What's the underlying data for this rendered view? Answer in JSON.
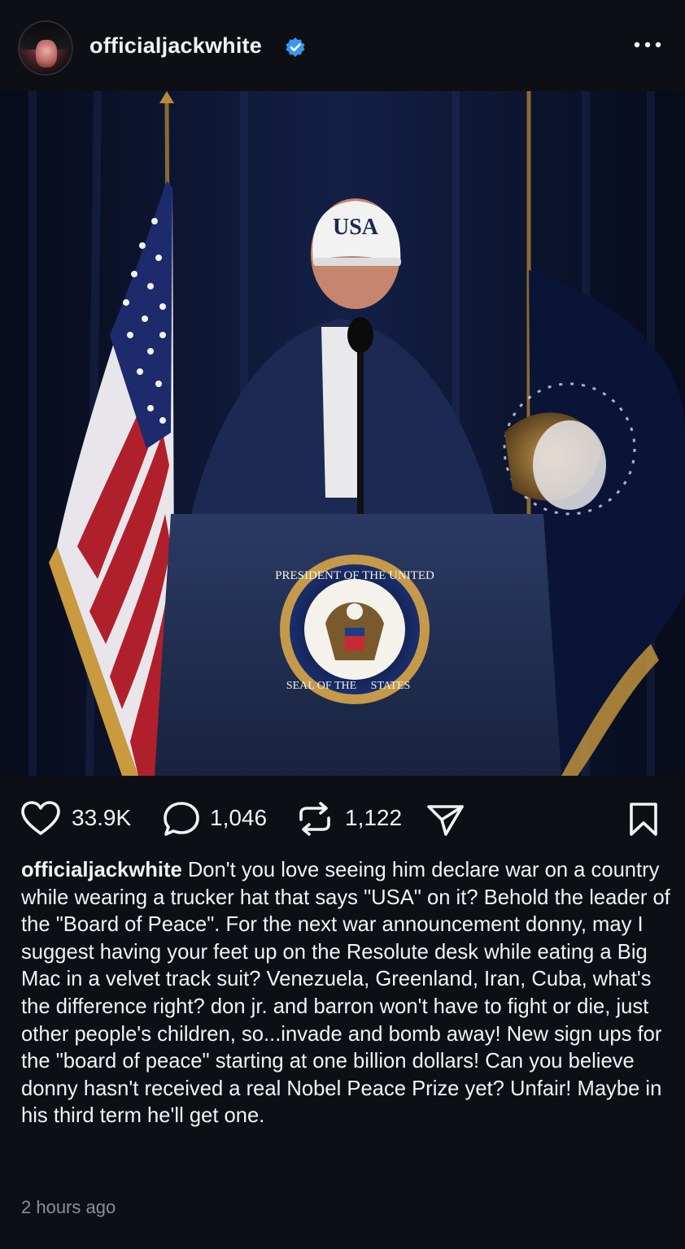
{
  "post": {
    "username": "officialjackwhite",
    "verified": true,
    "more_icon": "more-horizontal-icon"
  },
  "image": {
    "alt_signs": {
      "hat_text": "USA",
      "seal_text_top": "PRESIDENT OF THE UNITED",
      "seal_text_bottom": "SEAL OF THE",
      "seal_text_right": "STATES"
    }
  },
  "actions": {
    "likes": "33.9K",
    "comments": "1,046",
    "reposts": "1,122",
    "icons": [
      "heart-icon",
      "comment-icon",
      "repost-icon",
      "share-icon",
      "bookmark-icon"
    ]
  },
  "caption": {
    "username": "officialjackwhite",
    "text": "Don't you love seeing him declare war on a country while wearing a trucker hat that says \"USA\" on it? Behold the leader of the \"Board of Peace\". For the next war announcement donny, may I suggest having your feet up on the Resolute desk while eating a Big Mac in a velvet track suit? Venezuela, Greenland, Iran, Cuba, what's the difference right? don jr. and barron won't have to fight or die, just other people's children, so...invade and bomb away! New sign ups for the \"board of peace\" starting at one billion dollars! Can you believe donny hasn't received a real Nobel Peace Prize yet? Unfair! Maybe in his third term he'll get one."
  },
  "timestamp": "2 hours ago",
  "colors": {
    "background": "#0d0f14",
    "text": "#f2f3f5",
    "muted": "#8b8e96",
    "verified": "#3897f0"
  }
}
